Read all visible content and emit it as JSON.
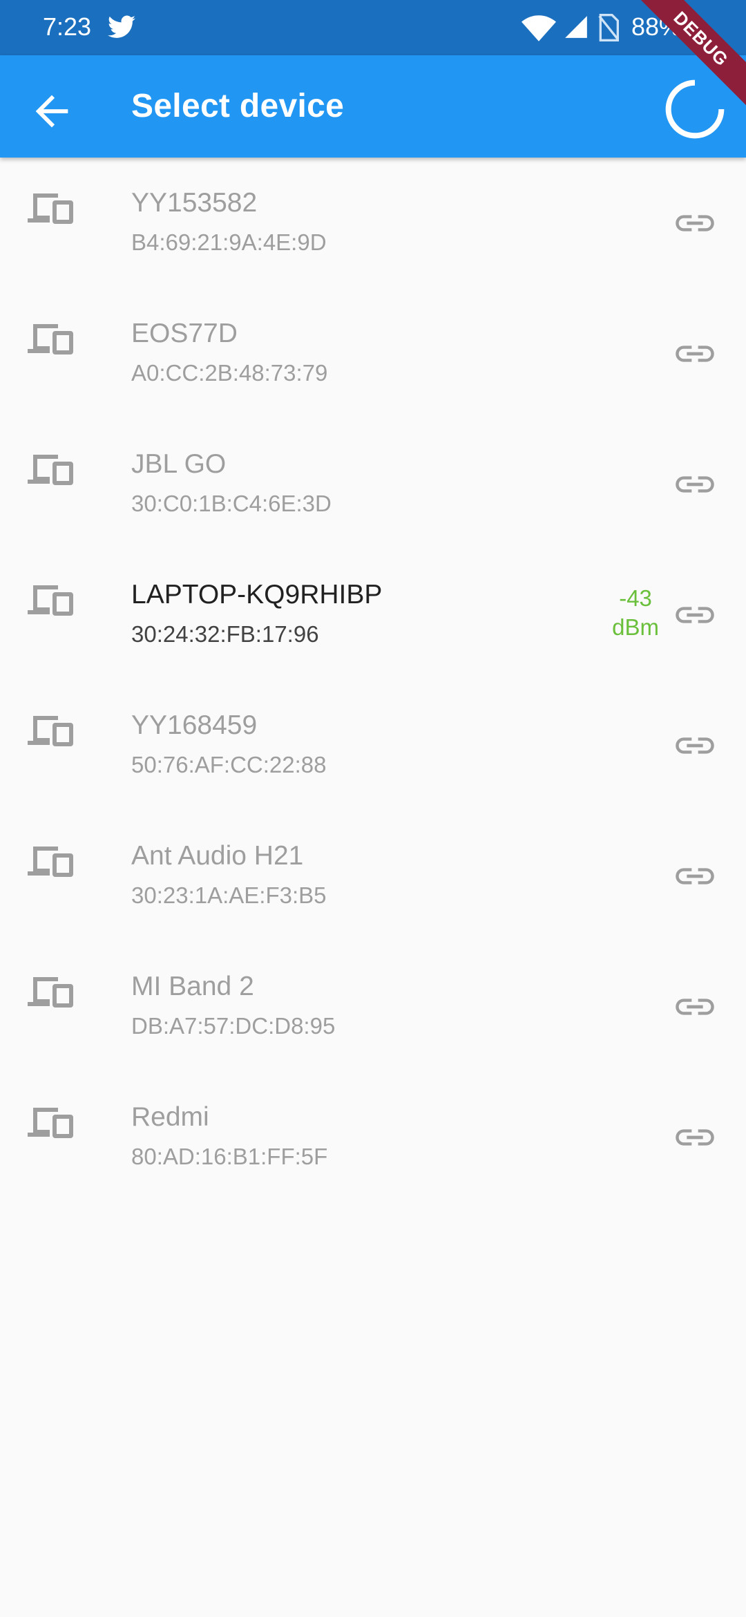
{
  "status_bar": {
    "time": "7:23",
    "battery": "88%"
  },
  "app_bar": {
    "title": "Select device",
    "debug_label": "DEBUG"
  },
  "devices": [
    {
      "name": "YY153582",
      "address": "B4:69:21:9A:4E:9D"
    },
    {
      "name": "EOS77D",
      "address": "A0:CC:2B:48:73:79"
    },
    {
      "name": "JBL GO",
      "address": "30:C0:1B:C4:6E:3D"
    },
    {
      "name": "LAPTOP-KQ9RHIBP",
      "address": "30:24:32:FB:17:96",
      "rssi_value": "-43",
      "rssi_unit": "dBm"
    },
    {
      "name": "YY168459",
      "address": "50:76:AF:CC:22:88"
    },
    {
      "name": "Ant Audio H21",
      "address": "30:23:1A:AE:F3:B5"
    },
    {
      "name": "MI Band 2",
      "address": "DB:A7:57:DC:D8:95"
    },
    {
      "name": "Redmi",
      "address": "80:AD:16:B1:FF:5F"
    }
  ],
  "colors": {
    "app_bar": "#2196f3",
    "status_bar": "#1a6fbf",
    "inactive_text": "#9e9e9e",
    "rssi": "#6abf3b"
  },
  "icons": {
    "device": "devices-icon",
    "link": "link-icon",
    "back": "arrow-back-icon",
    "refresh": "progress-spinner-icon"
  }
}
